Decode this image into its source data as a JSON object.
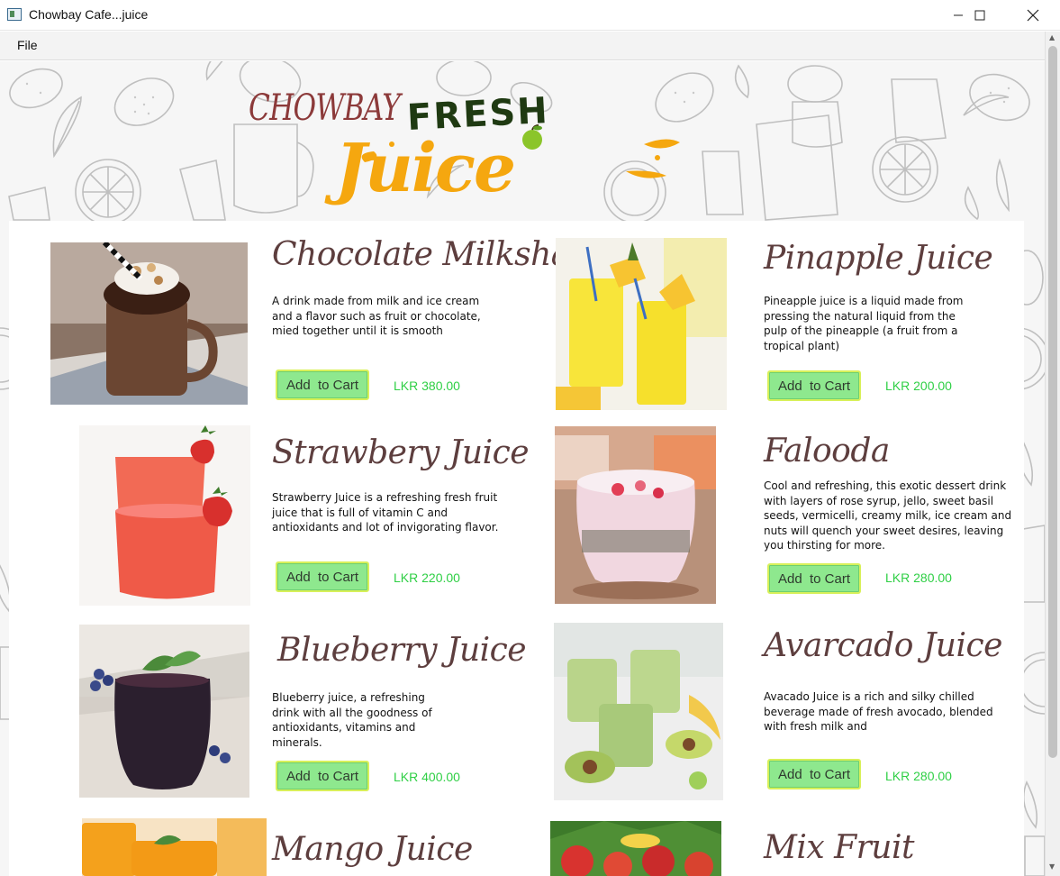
{
  "window": {
    "title": "Chowbay Cafe...juice",
    "min_icon": "minimize-icon",
    "max_icon": "maximize-icon",
    "close_icon": "close-icon"
  },
  "menu": {
    "file": "File"
  },
  "logo": {
    "brand": "CHOWBAY",
    "fresh": "FRESH",
    "juice": "Juice"
  },
  "products": [
    {
      "name": "Chocolate Milkshake",
      "desc": "A  drink made from milk and ice cream and a flavor such as fruit or chocolate, mied together until it is smooth",
      "button": "Add  to Cart",
      "price": "LKR 380.00",
      "image": "chocolate-milkshake-photo"
    },
    {
      "name": "Pinapple Juice",
      "desc": "Pineapple juice is a liquid made from pressing the natural liquid from the pulp of the pineapple (a fruit from a tropical plant)",
      "button": "Add  to Cart",
      "price": "LKR 200.00",
      "image": "pineapple-juice-photo"
    },
    {
      "name": "Strawbery Juice",
      "desc": "Strawberry Juice is a refreshing fresh fruit juice that is full of vitamin C and antioxidants and lot of invigorating flavor.",
      "button": "Add  to Cart",
      "price": "LKR 220.00",
      "image": "strawberry-juice-photo"
    },
    {
      "name": "Falooda",
      "desc": "Cool and refreshing, this exotic dessert drink with layers of rose syrup, jello, sweet basil seeds, vermicelli, creamy milk, ice cream and nuts will quench your sweet desires, leaving you thirsting for more.",
      "button": "Add  to Cart",
      "price": "LKR 280.00",
      "image": "falooda-photo"
    },
    {
      "name": "Blueberry Juice",
      "desc": "Blueberry juice, a refreshing drink with all the goodness of antioxidants, vitamins and minerals.",
      "button": "Add  to Cart",
      "price": "LKR 400.00",
      "image": "blueberry-juice-photo"
    },
    {
      "name": "Avarcado Juice",
      "desc": "Avacado Juice is a rich and silky chilled beverage made of fresh avocado, blended with fresh milk and",
      "button": "Add  to Cart",
      "price": "LKR 280.00",
      "image": "avocado-juice-photo"
    },
    {
      "name": "Mango Juice",
      "image": "mango-juice-photo"
    },
    {
      "name": "Mix Fruit",
      "image": "mix-fruit-photo"
    }
  ],
  "colors": {
    "button_bg": "#8ee88e",
    "button_border": "#d8f05a",
    "price": "#2fcf45",
    "title": "#5d3e3e",
    "juice_logo": "#f5a70f"
  }
}
